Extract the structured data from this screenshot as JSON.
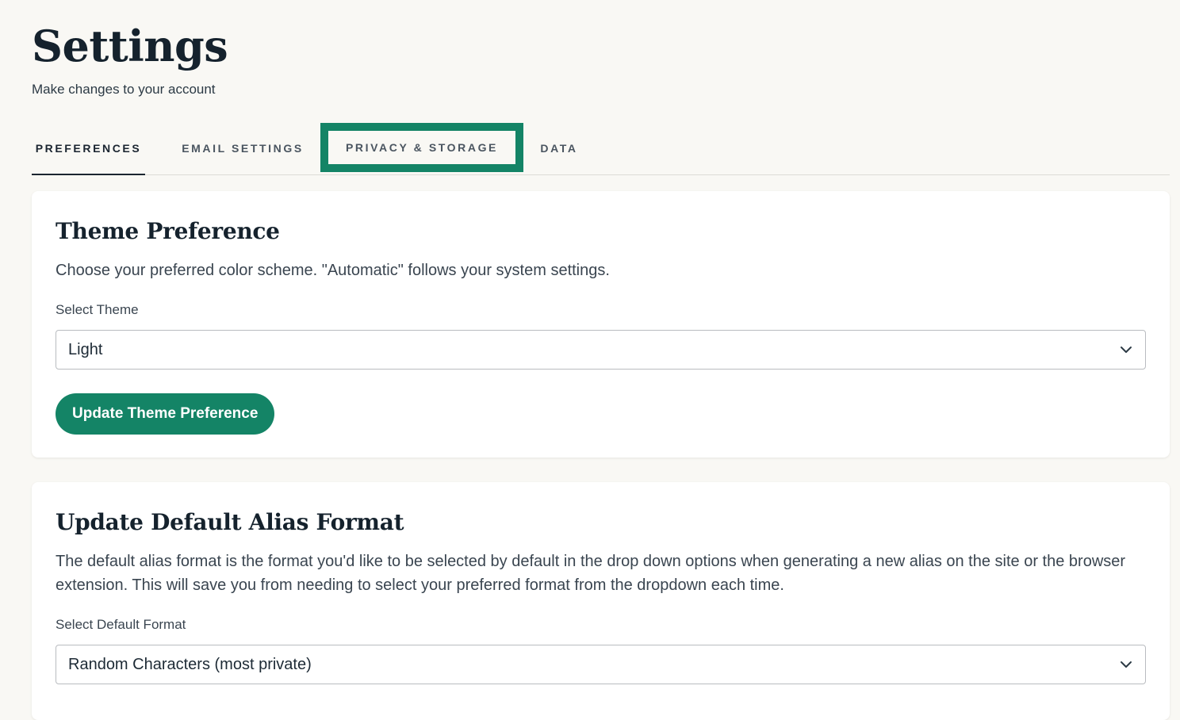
{
  "header": {
    "title": "Settings",
    "subtitle": "Make changes to your account"
  },
  "tabs": [
    {
      "label": "PREFERENCES",
      "active": true
    },
    {
      "label": "EMAIL SETTINGS",
      "active": false
    },
    {
      "label": "PRIVACY & STORAGE",
      "active": false,
      "highlighted": true
    },
    {
      "label": "DATA",
      "active": false
    }
  ],
  "theme_card": {
    "title": "Theme Preference",
    "description": "Choose your preferred color scheme. \"Automatic\" follows your system settings.",
    "select_label": "Select Theme",
    "select_value": "Light",
    "button_label": "Update Theme Preference"
  },
  "alias_card": {
    "title": "Update Default Alias Format",
    "description": "The default alias format is the format you'd like to be selected by default in the drop down options when generating a new alias on the site or the browser extension. This will save you from needing to select your preferred format from the dropdown each time.",
    "select_label": "Select Default Format",
    "select_value": "Random Characters (most private)"
  },
  "colors": {
    "accent": "#148466",
    "background": "#f9f8f4",
    "text": "#15222d"
  },
  "icons": {
    "select_chevron": "chevron-down-icon"
  }
}
